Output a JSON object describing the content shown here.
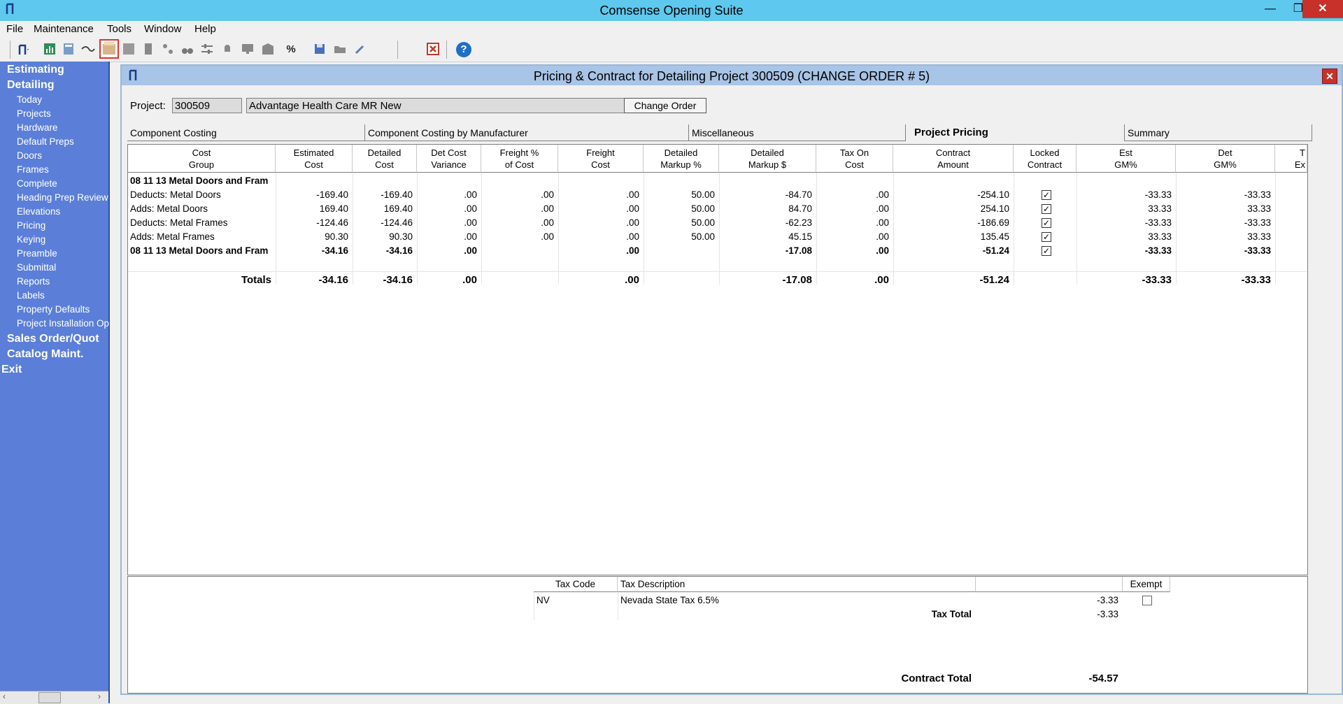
{
  "window": {
    "title": "Comsense Opening Suite"
  },
  "menu": [
    "File",
    "Maintenance",
    "Tools",
    "Window",
    "Help"
  ],
  "toolbar": {
    "icons": [
      "app-menu-icon",
      "chart-icon",
      "calculator-icon",
      "handshake-icon",
      "sold-icon",
      "grid-icon",
      "door-icon",
      "hierarchy-icon",
      "binoculars-icon",
      "filter-icon",
      "bell-icon",
      "monitor-icon",
      "cabinet-icon",
      "percent-icon",
      "save-icon",
      "folder-icon",
      "pencil-icon",
      "close-icon",
      "help-icon"
    ],
    "percent_glyph": "%",
    "help_glyph": "?"
  },
  "sidebar": {
    "sections": [
      "Estimating",
      "Detailing",
      "Sales Order/Quot",
      "Catalog Maint.",
      "Exit"
    ],
    "detailing_items": [
      "Today",
      "Projects",
      "Hardware",
      "Default Preps",
      "Doors",
      "Frames",
      "Complete",
      "Heading Prep Review",
      "Elevations",
      "Pricing",
      "Keying",
      "Preamble",
      "Submittal",
      "Reports",
      "Labels",
      "Property Defaults",
      "Project Installation Op"
    ]
  },
  "child": {
    "title": "Pricing & Contract for Detailing Project 300509   (CHANGE ORDER # 5)",
    "project_label": "Project:",
    "project_number": "300509",
    "project_name": "Advantage Health Care MR New",
    "change_order_button": "Change Order",
    "tabs": [
      "Component Costing",
      "Component Costing by Manufacturer",
      "Miscellaneous",
      "Project Pricing",
      "Summary"
    ],
    "active_tab": "Project Pricing"
  },
  "grid": {
    "columns": [
      "Cost\nGroup",
      "Estimated\nCost",
      "Detailed\nCost",
      "Det Cost\nVariance",
      "Freight %\nof Cost",
      "Freight\nCost",
      "Detailed\nMarkup %",
      "Detailed\nMarkup $",
      "Tax On\nCost",
      "Contract\nAmount",
      "Locked\nContract",
      "Est\nGM%",
      "Det\nGM%",
      "T\nEx"
    ],
    "rows": [
      {
        "group": "08 11 13 Metal Doors and Fram",
        "bold": true,
        "vals": [
          "",
          "",
          "",
          "",
          "",
          "",
          "",
          "",
          "",
          ""
        ],
        "locked": null,
        "est_gm": "",
        "det_gm": ""
      },
      {
        "group": "Deducts: Metal Doors",
        "bold": false,
        "vals": [
          "-169.40",
          "-169.40",
          ".00",
          ".00",
          ".00",
          "50.00",
          "-84.70",
          ".00",
          "-254.10"
        ],
        "locked": true,
        "est_gm": "-33.33",
        "det_gm": "-33.33"
      },
      {
        "group": "Adds: Metal Doors",
        "bold": false,
        "vals": [
          "169.40",
          "169.40",
          ".00",
          ".00",
          ".00",
          "50.00",
          "84.70",
          ".00",
          "254.10"
        ],
        "locked": true,
        "est_gm": "33.33",
        "det_gm": "33.33"
      },
      {
        "group": "Deducts: Metal Frames",
        "bold": false,
        "vals": [
          "-124.46",
          "-124.46",
          ".00",
          ".00",
          ".00",
          "50.00",
          "-62.23",
          ".00",
          "-186.69"
        ],
        "locked": true,
        "est_gm": "-33.33",
        "det_gm": "-33.33"
      },
      {
        "group": "Adds: Metal Frames",
        "bold": false,
        "vals": [
          "90.30",
          "90.30",
          ".00",
          ".00",
          ".00",
          "50.00",
          "45.15",
          ".00",
          "135.45"
        ],
        "locked": true,
        "est_gm": "33.33",
        "det_gm": "33.33"
      },
      {
        "group": "08 11 13 Metal Doors and Fram",
        "bold": true,
        "vals": [
          "-34.16",
          "-34.16",
          ".00",
          "",
          ".00",
          "",
          "-17.08",
          ".00",
          "-51.24"
        ],
        "locked": true,
        "est_gm": "-33.33",
        "det_gm": "-33.33"
      }
    ],
    "totals": {
      "label": "Totals",
      "vals": [
        "-34.16",
        "-34.16",
        ".00",
        "",
        ".00",
        "",
        "-17.08",
        ".00",
        "-51.24"
      ],
      "est_gm": "-33.33",
      "det_gm": "-33.33"
    }
  },
  "tax": {
    "headers": {
      "code": "Tax Code",
      "description": "Tax Description",
      "exempt": "Exempt"
    },
    "row": {
      "code": "NV",
      "description": "Nevada State Tax 6.5%",
      "amount": "-3.33",
      "exempt": false
    },
    "tax_total_label": "Tax Total",
    "tax_total": "-3.33",
    "contract_total_label": "Contract Total",
    "contract_total": "-54.57"
  }
}
